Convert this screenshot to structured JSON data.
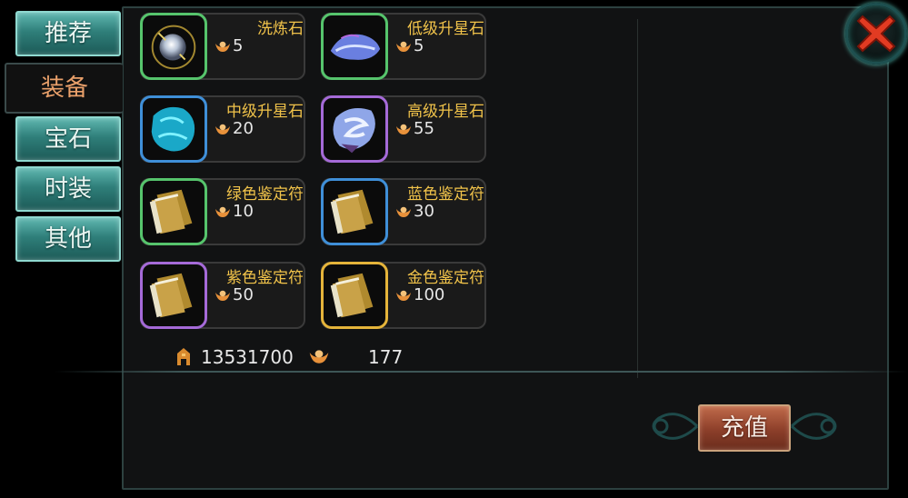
{
  "tabs": [
    {
      "label": "推荐",
      "active": false
    },
    {
      "label": "装备",
      "active": true
    },
    {
      "label": "宝石",
      "active": false
    },
    {
      "label": "时装",
      "active": false
    },
    {
      "label": "其他",
      "active": false
    }
  ],
  "items": [
    {
      "name": "洗炼石",
      "price": "5",
      "frame_color": "#56c46c",
      "icon": "wash-stone-icon"
    },
    {
      "name": "低级升星石",
      "price": "5",
      "frame_color": "#56c46c",
      "icon": "low-star-stone-icon"
    },
    {
      "name": "中级升星石",
      "price": "20",
      "frame_color": "#3f8fd8",
      "icon": "mid-star-stone-icon"
    },
    {
      "name": "高级升星石",
      "price": "55",
      "frame_color": "#a56ad8",
      "icon": "high-star-stone-icon"
    },
    {
      "name": "绿色鉴定符",
      "price": "10",
      "frame_color": "#56c46c",
      "icon": "scroll-icon"
    },
    {
      "name": "蓝色鉴定符",
      "price": "30",
      "frame_color": "#3f8fd8",
      "icon": "scroll-icon"
    },
    {
      "name": "紫色鉴定符",
      "price": "50",
      "frame_color": "#a56ad8",
      "icon": "scroll-icon"
    },
    {
      "name": "金色鉴定符",
      "price": "100",
      "frame_color": "#e5b43a",
      "icon": "scroll-icon"
    }
  ],
  "footer": {
    "gold": "13531700",
    "ingots": "177"
  },
  "recharge_label": "充值",
  "colors": {
    "item_name": "#f1c34a",
    "tab_active_text": "#e9a06a",
    "tab_bg": "#2f7f7a"
  }
}
